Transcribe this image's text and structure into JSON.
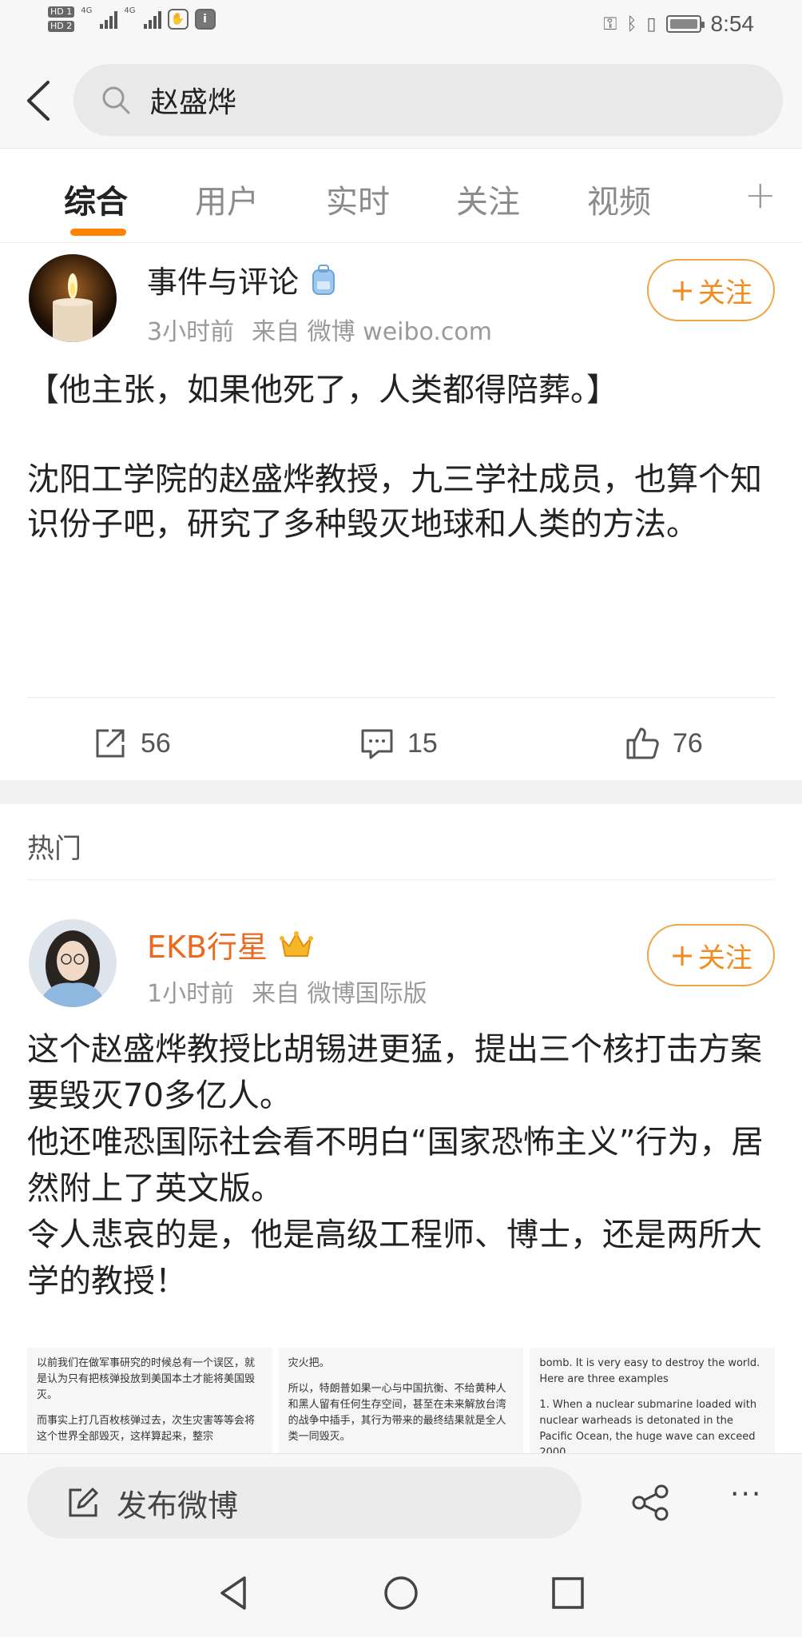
{
  "status_bar": {
    "hd1": "HD 1",
    "hd2": "HD 2",
    "net1": "4G",
    "net2": "4G",
    "time": "8:54"
  },
  "search": {
    "query": "赵盛烨"
  },
  "tabs": [
    {
      "label": "综合",
      "active": true
    },
    {
      "label": "用户"
    },
    {
      "label": "实时"
    },
    {
      "label": "关注"
    },
    {
      "label": "视频"
    }
  ],
  "tab_add": "+",
  "posts": [
    {
      "author": "事件与评论",
      "time": "3小时前",
      "source": "来自 微博 weibo.com",
      "follow_label": "关注",
      "paragraphs": [
        "【他主张，如果他死了，人类都得陪葬。】",
        "",
        "沈阳工学院的赵盛烨教授，九三学社成员，也算个知识份子吧，研究了多种毁灭地球和人类的方法。"
      ],
      "reposts": "56",
      "comments": "15",
      "likes": "76"
    },
    {
      "author": "EKB行星",
      "time": "1小时前",
      "source": "来自 微博国际版",
      "follow_label": "关注",
      "paragraphs": [
        "这个赵盛烨教授比胡锡进更猛，提出三个核打击方案要毁灭70多亿人。",
        "他还唯恐国际社会看不明白“国家恐怖主义”行为，居然附上了英文版。",
        "令人悲哀的是，他是高级工程师、博士，还是两所大学的教授！"
      ],
      "images": [
        [
          "以前我们在做军事研究的时候总有一个误区，就是认为只有把核弹投放到美国本土才能将美国毁灭。",
          "而事实上打几百枚核弹过去，次生灾害等等会将这个世界全部毁灭，这样算起来，整宗"
        ],
        [
          "灾火把。",
          "所以，特朗普如果一心与中国抗衡、不给黄种人和黑人留有任何生存空间，甚至在未来解放台湾的战争中插手，其行为带来的最终结果就是全人类一同毁灭。"
        ],
        [
          "bomb. It is very easy to destroy the world. Here are three examples",
          "1. When a nuclear submarine loaded with nuclear warheads is detonated in the Pacific Ocean, the huge wave can exceed 2000"
        ]
      ]
    }
  ],
  "section_label": "热门",
  "compose": {
    "placeholder": "发布微博",
    "more": "···"
  },
  "colors": {
    "accent": "#ff8200",
    "follow": "#f08c1f",
    "author_vip": "#e86b1f"
  }
}
